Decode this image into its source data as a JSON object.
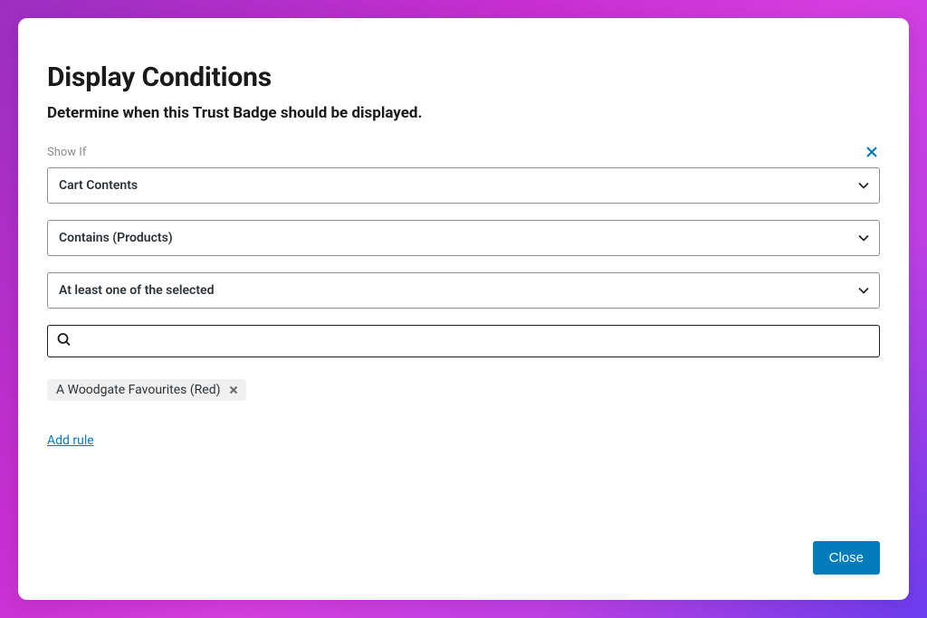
{
  "header": {
    "title": "Display Conditions",
    "subtitle": "Determine when this Trust Badge should be displayed."
  },
  "rule": {
    "label": "Show If",
    "condition_type": "Cart Contents",
    "operator": "Contains (Products)",
    "match_mode": "At least one of the selected",
    "search_value": ""
  },
  "tags": [
    {
      "label": "A Woodgate Favourites (Red)"
    }
  ],
  "actions": {
    "add_rule": "Add rule",
    "close": "Close"
  }
}
